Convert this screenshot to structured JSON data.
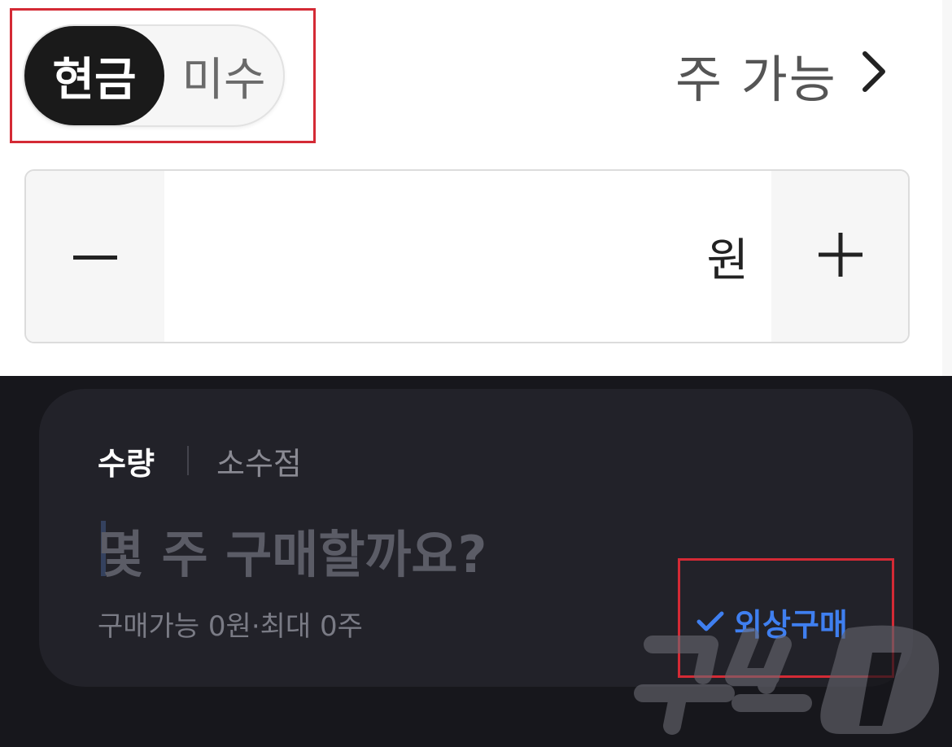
{
  "top": {
    "toggle": {
      "options": [
        "현금",
        "미수"
      ],
      "selected": "현금"
    },
    "available_link": {
      "label": "주 가능",
      "chevron_icon": "chevron-right-icon"
    },
    "price_stepper": {
      "minus_icon": "minus-icon",
      "plus_icon": "plus-icon",
      "value": "",
      "unit": "원"
    }
  },
  "bottom": {
    "tabs": [
      {
        "label": "수량",
        "active": true
      },
      {
        "label": "소수점",
        "active": false
      }
    ],
    "question_placeholder": "몇 주 구매할까요?",
    "available_info": "구매가능 0원·최대 0주",
    "credit_purchase": {
      "label": "외상구매",
      "checked": true,
      "icon": "check-icon"
    }
  },
  "colors": {
    "highlight": "#d42a35",
    "accent_blue": "#3f7ff0",
    "dark_bg": "#17171c",
    "card_bg": "#222229"
  },
  "watermark": {
    "text": "뉴스1"
  }
}
